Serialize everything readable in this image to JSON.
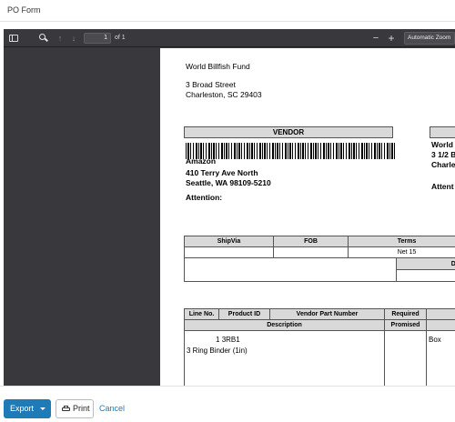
{
  "window": {
    "title": "PO Form"
  },
  "viewer": {
    "toolbar": {
      "page_current": "1",
      "page_count": "of 1",
      "zoom_out": "−",
      "zoom_in": "+",
      "zoom_level": "Automatic Zoom",
      "up_arrow": "↑",
      "down_arrow": "↓"
    },
    "document": {
      "buyer": {
        "name": "World Billfish Fund",
        "address_line1": "3 Broad Street",
        "address_line2": "Charleston, SC 29403"
      },
      "vendor_box_label": "VENDOR",
      "vendor": {
        "name": "Amazon",
        "address_line1": "410 Terry Ave North",
        "address_line2": "Seattle, WA 98109-5210",
        "attention": "Attention:"
      },
      "ship_to": {
        "name": "World",
        "address_line1": "3 1/2 B",
        "address_line2": "Charle",
        "attention": "Attent"
      },
      "terms_table": {
        "headers": [
          "ShipVia",
          "FOB",
          "Terms"
        ],
        "values": [
          "",
          "",
          "Net 15"
        ],
        "sub_header": "Dep"
      },
      "lines_table": {
        "headers": [
          "Line No.",
          "Product ID",
          "Vendor Part Number",
          "Required"
        ],
        "headers_row2": [
          "Description",
          "Promised"
        ],
        "rows": [
          {
            "line": "1",
            "product_id": "3RB1",
            "unit": "Box",
            "description": "3 Ring Binder (1in)"
          }
        ]
      }
    }
  },
  "footer": {
    "export_label": "Export",
    "print_label": "Print",
    "cancel_label": "Cancel"
  },
  "colors": {
    "primary": "#1f7ab8",
    "viewer_bg": "#38383d",
    "table_header": "#d9d9d9"
  }
}
